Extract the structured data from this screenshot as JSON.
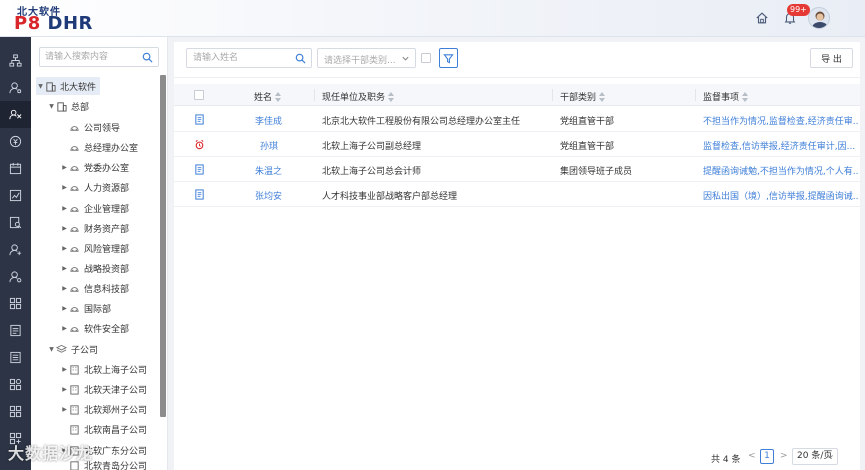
{
  "brand": {
    "top": "北大软件",
    "p8": "P8",
    "dhr": "DHR"
  },
  "header": {
    "badge": "99+"
  },
  "tree": {
    "search_placeholder": "请输入搜索内容",
    "nodes": [
      {
        "label": "北大软件"
      },
      {
        "label": "总部"
      },
      {
        "label": "公司领导"
      },
      {
        "label": "总经理办公室"
      },
      {
        "label": "党委办公室"
      },
      {
        "label": "人力资源部"
      },
      {
        "label": "企业管理部"
      },
      {
        "label": "财务资产部"
      },
      {
        "label": "风险管理部"
      },
      {
        "label": "战略投资部"
      },
      {
        "label": "信息科技部"
      },
      {
        "label": "国际部"
      },
      {
        "label": "软件安全部"
      },
      {
        "label": "子公司"
      },
      {
        "label": "北软上海子公司"
      },
      {
        "label": "北软天津子公司"
      },
      {
        "label": "北软郑州子公司"
      },
      {
        "label": "北软南昌子公司"
      },
      {
        "label": "北软广东分公司"
      },
      {
        "label": "北软青岛分公司"
      }
    ]
  },
  "toolbar": {
    "name_placeholder": "请输入姓名",
    "category_placeholder": "请选择干部类别...",
    "export_label": "导 出"
  },
  "table": {
    "headers": {
      "name": "姓名",
      "position": "现任单位及职务",
      "category": "干部类别",
      "supervision": "监督事项"
    },
    "rows": [
      {
        "icon": "document-icon",
        "name": "李佳成",
        "position": "北京北大软件工程股份有限公司总经理办公室主任",
        "category": "党组直管干部",
        "supervision": "不担当作为情况,监督检查,经济责任审..."
      },
      {
        "icon": "alarm-icon",
        "name": "孙琪",
        "position": "北软上海子公司副总经理",
        "category": "党组直管干部",
        "supervision": "监督检查,信访举报,经济责任审计,因..."
      },
      {
        "icon": "document-icon",
        "name": "朱温之",
        "position": "北软上海子公司总会计师",
        "category": "集团领导班子成员",
        "supervision": "提醒函询诫勉,不担当作为情况,个人有..."
      },
      {
        "icon": "document-icon",
        "name": "张均安",
        "position": "人才科技事业部战略客户部总经理",
        "category": "",
        "supervision": "因私出国（境）,信访举报,提醒函询诫..."
      }
    ]
  },
  "pager": {
    "total": "共 4 条",
    "prev": "<",
    "page": "1",
    "next": ">",
    "size": "20 条/页"
  },
  "watermark": "大数据沙龙",
  "colors": {
    "accent": "#3f7fd8",
    "rail": "#2d3445",
    "alarm": "#d9262b",
    "brand": "#1f3a78"
  }
}
